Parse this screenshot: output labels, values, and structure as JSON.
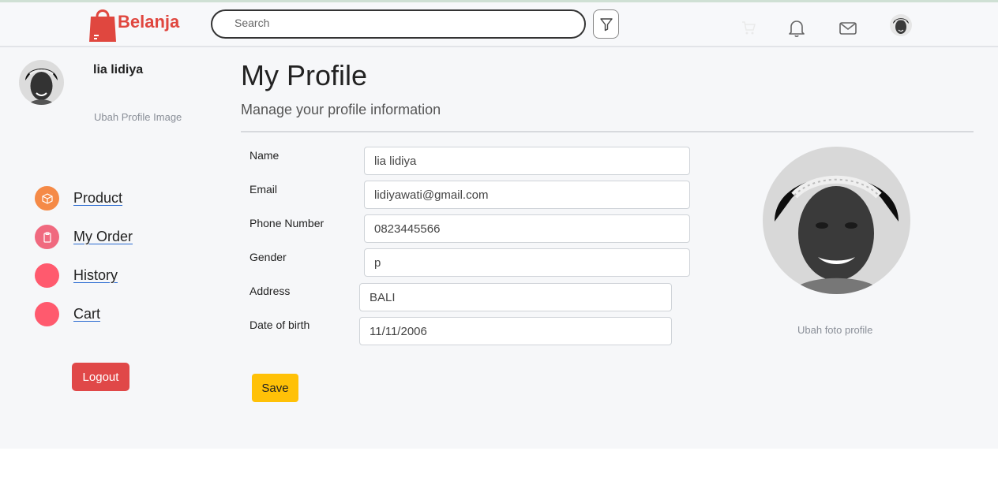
{
  "header": {
    "brand": "Belanja",
    "search_placeholder": "Search",
    "icons": [
      "filter-icon",
      "cart-icon",
      "bell-icon",
      "mail-icon"
    ],
    "brand_color": "#e0473f"
  },
  "sidebar": {
    "user_name": "lia lidiya",
    "change_image": "Ubah Profile Image",
    "nav": [
      {
        "label": "Product",
        "color": "#f58a47",
        "icon": "box-icon"
      },
      {
        "label": "My Order",
        "color": "#f0697f",
        "icon": "clipboard-icon"
      },
      {
        "label": "History",
        "color": "#ff5a6e",
        "icon": ""
      },
      {
        "label": "Cart",
        "color": "#ff5a6e",
        "icon": ""
      }
    ],
    "logout": "Logout"
  },
  "main": {
    "title": "My Profile",
    "subtitle": "Manage your profile information",
    "fields": [
      {
        "label": "Name",
        "value": "lia lidiya"
      },
      {
        "label": "Email",
        "value": "lidiyawati@gmail.com"
      },
      {
        "label": "Phone Number",
        "value": "0823445566"
      },
      {
        "label": "Gender",
        "value": "p"
      },
      {
        "label": "Address",
        "value": "BALI"
      },
      {
        "label": "Date of birth",
        "value": "11/11/2006"
      }
    ],
    "save": "Save",
    "change_photo": "Ubah foto profile"
  }
}
